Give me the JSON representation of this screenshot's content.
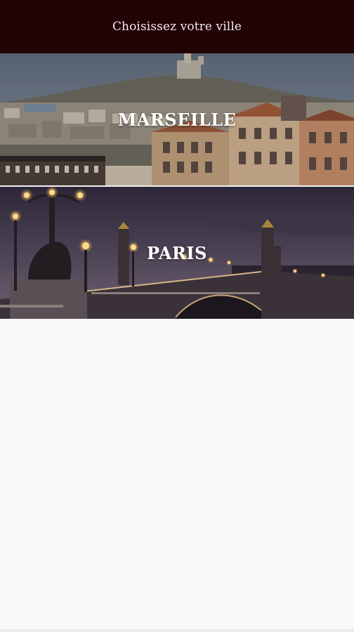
{
  "header": {
    "title": "Choisissez votre ville"
  },
  "cities": [
    {
      "name": "MARSEILLE",
      "image": "marseille-cityscape"
    },
    {
      "name": "PARIS",
      "image": "paris-bridge-night"
    }
  ],
  "colors": {
    "header_bg": "#220306",
    "header_text": "#f3ecec",
    "page_bg": "#f9f9f9"
  }
}
